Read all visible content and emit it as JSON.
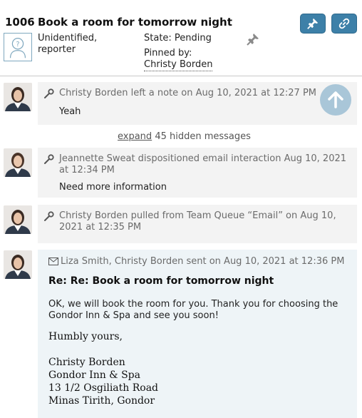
{
  "ticket": {
    "id": "1006",
    "title": "Book a room for tomorrow night",
    "reporter": "Unidentified, reporter",
    "state": "State: Pending",
    "pinned_label": "Pinned by:",
    "pinned_by": "Christy Borden"
  },
  "header_buttons": {
    "pin_icon": "pin-icon",
    "link_icon": "link-icon",
    "accent": "#3d80a8"
  },
  "timeline": {
    "note": {
      "meta": "Christy Borden left a note on Aug 10, 2021 at 12:27 PM",
      "body": "Yeah"
    },
    "expander": {
      "link": "expand",
      "text": "45 hidden messages"
    },
    "disposition": {
      "meta": "Jeannette Sweat dispositioned email interaction Aug 10, 2021 at 12:34 PM",
      "body": "Need more information"
    },
    "pull": {
      "meta": "Christy Borden pulled from Team Queue “Email” on Aug 10, 2021 at 12:35 PM"
    },
    "email": {
      "meta": "Liza Smith, Christy Borden sent on Aug 10, 2021 at 12:36 PM",
      "subject": "Re: Re: Book a room for tomorrow night",
      "paragraph": "OK, we will book the room for you. Thank you for choosing the Gondor Inn & Spa and see you soon!",
      "closing": "Humbly yours,",
      "signature": [
        "Christy Borden",
        "Gondor Inn & Spa",
        "13 1/2 Osgiliath Road",
        "Minas Tirith, Gondor"
      ]
    }
  }
}
